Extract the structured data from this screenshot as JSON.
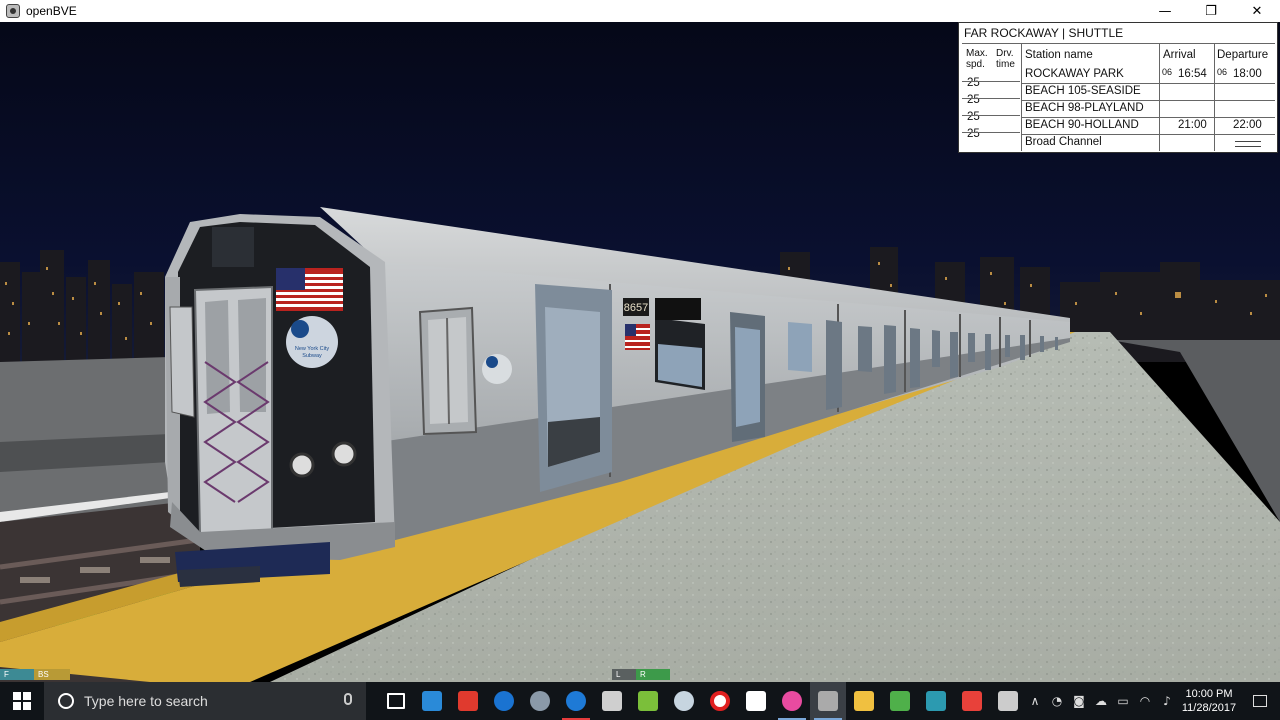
{
  "window": {
    "title": "openBVE",
    "minimize_glyph": "—",
    "maximize_glyph": "❐",
    "close_glyph": "✕"
  },
  "scene": {
    "car_number": "8657",
    "train_description": "R160 subway train at elevated station platform at night"
  },
  "timetable": {
    "title": "FAR ROCKAWAY | SHUTTLE",
    "headers": {
      "max_spd_line1": "Max.",
      "max_spd_line2": "spd.",
      "drv_time_line1": "Drv.",
      "drv_time_line2": "time",
      "station": "Station name",
      "arrival": "Arrival",
      "departure": "Departure"
    },
    "speeds": [
      "25",
      "25",
      "25",
      "25"
    ],
    "rows": [
      {
        "station": "ROCKAWAY PARK",
        "arr_hour": "06",
        "arr_time": "16:54",
        "dep_hour": "06",
        "dep_time": "18:00"
      },
      {
        "station": "BEACH 105-SEASIDE",
        "arr_hour": "",
        "arr_time": "",
        "dep_hour": "",
        "dep_time": ""
      },
      {
        "station": "BEACH 98-PLAYLAND",
        "arr_hour": "",
        "arr_time": "",
        "dep_hour": "",
        "dep_time": ""
      },
      {
        "station": "BEACH 90-HOLLAND",
        "arr_hour": "",
        "arr_time": "21:00",
        "dep_hour": "",
        "dep_time": "22:00"
      },
      {
        "station": "Broad Channel",
        "arr_hour": "",
        "arr_time": "",
        "dep_hour": "",
        "dep_time": ""
      }
    ]
  },
  "hud": {
    "left_f": "F",
    "left_bs": "BS",
    "center_l": "L",
    "center_r": "R"
  },
  "taskbar": {
    "search_placeholder": "Type here to search",
    "clock_time": "10:00 PM",
    "clock_date": "11/28/2017",
    "apps": [
      {
        "name": "task-view",
        "color": "#ffffff"
      },
      {
        "name": "app-blue-arrow",
        "color": "#2a8ad8"
      },
      {
        "name": "app-red-bars",
        "color": "#e03a2e"
      },
      {
        "name": "app-teamviewer",
        "color": "#1a73d1"
      },
      {
        "name": "app-gray-moon",
        "color": "#8a99a8"
      },
      {
        "name": "edge",
        "color": "#1e7ad6"
      },
      {
        "name": "app-iv",
        "color": "#cfcfcf"
      },
      {
        "name": "app-gta",
        "color": "#7bbf3a"
      },
      {
        "name": "steam",
        "color": "#c7d5e0"
      },
      {
        "name": "record",
        "color": "#e02020"
      },
      {
        "name": "store",
        "color": "#ffffff"
      },
      {
        "name": "itunes",
        "color": "#e84ba0"
      },
      {
        "name": "openbve",
        "color": "#aaaaaa"
      },
      {
        "name": "file-explorer",
        "color": "#f0c040"
      },
      {
        "name": "photos",
        "color": "#4fb04a"
      },
      {
        "name": "app-teal",
        "color": "#2c9ab0"
      },
      {
        "name": "app-red-square",
        "color": "#e8413a"
      },
      {
        "name": "audio-wave",
        "color": "#cccccc"
      }
    ]
  }
}
